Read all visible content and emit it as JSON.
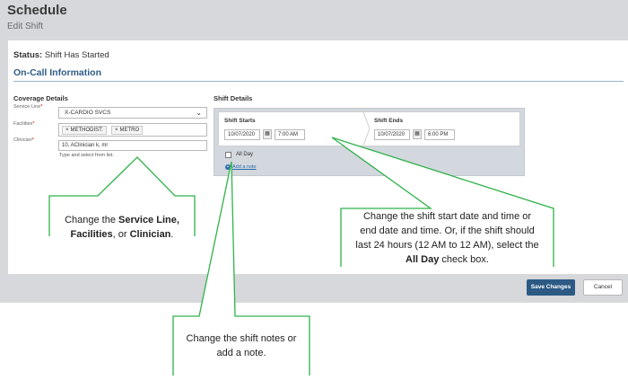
{
  "page": {
    "title": "Schedule",
    "subtitle": "Edit Shift"
  },
  "status": {
    "label": "Status:",
    "value": "Shift Has Started"
  },
  "section_title": "On-Call Information",
  "coverage": {
    "heading": "Coverage Details",
    "service_line_label": "Service Line",
    "service_line_value": "X-CARDIO SVCS",
    "facilities_label": "Facilities",
    "facilities": [
      "METHODIST:",
      "METRO"
    ],
    "clinician_label": "Clinician",
    "clinician_value": "10, AClinician k, mr",
    "clinician_hint": "Type and select from list."
  },
  "shift": {
    "heading": "Shift Details",
    "starts_label": "Shift Starts",
    "start_date": "10/07/2020",
    "start_time": "7:00 AM",
    "ends_label": "Shift Ends",
    "end_date": "10/07/2020",
    "end_time": "6:00 PM",
    "all_day_label": "All Day",
    "add_note_label": "Add a note"
  },
  "buttons": {
    "save": "Save Changes",
    "cancel": "Cancel"
  },
  "callouts": {
    "coverage": {
      "pre": "Change the ",
      "b1": "Service Line,",
      "b2": "Facilities",
      "mid": ", or ",
      "b3": "Clinician",
      "post": "."
    },
    "shift": {
      "line1": "Change the shift start date and time or",
      "line2": "end date and time. Or, if the shift should",
      "line3": "last 24 hours (12 AM to 12 AM), select the",
      "b": "All Day",
      "post": " check box."
    },
    "notes": {
      "line1": "Change the shift notes or",
      "line2": "add a note."
    }
  },
  "icons": {
    "required": "*",
    "chevron": "chevron-down-icon",
    "calendar": "calendar-icon",
    "plus": "plus-circle-icon",
    "tag_remove": "x-icon"
  },
  "colors": {
    "accent": "#2f5d86",
    "save_button": "#2c5a85",
    "callout_line": "#2fb24a",
    "link": "#2a6ab0"
  }
}
